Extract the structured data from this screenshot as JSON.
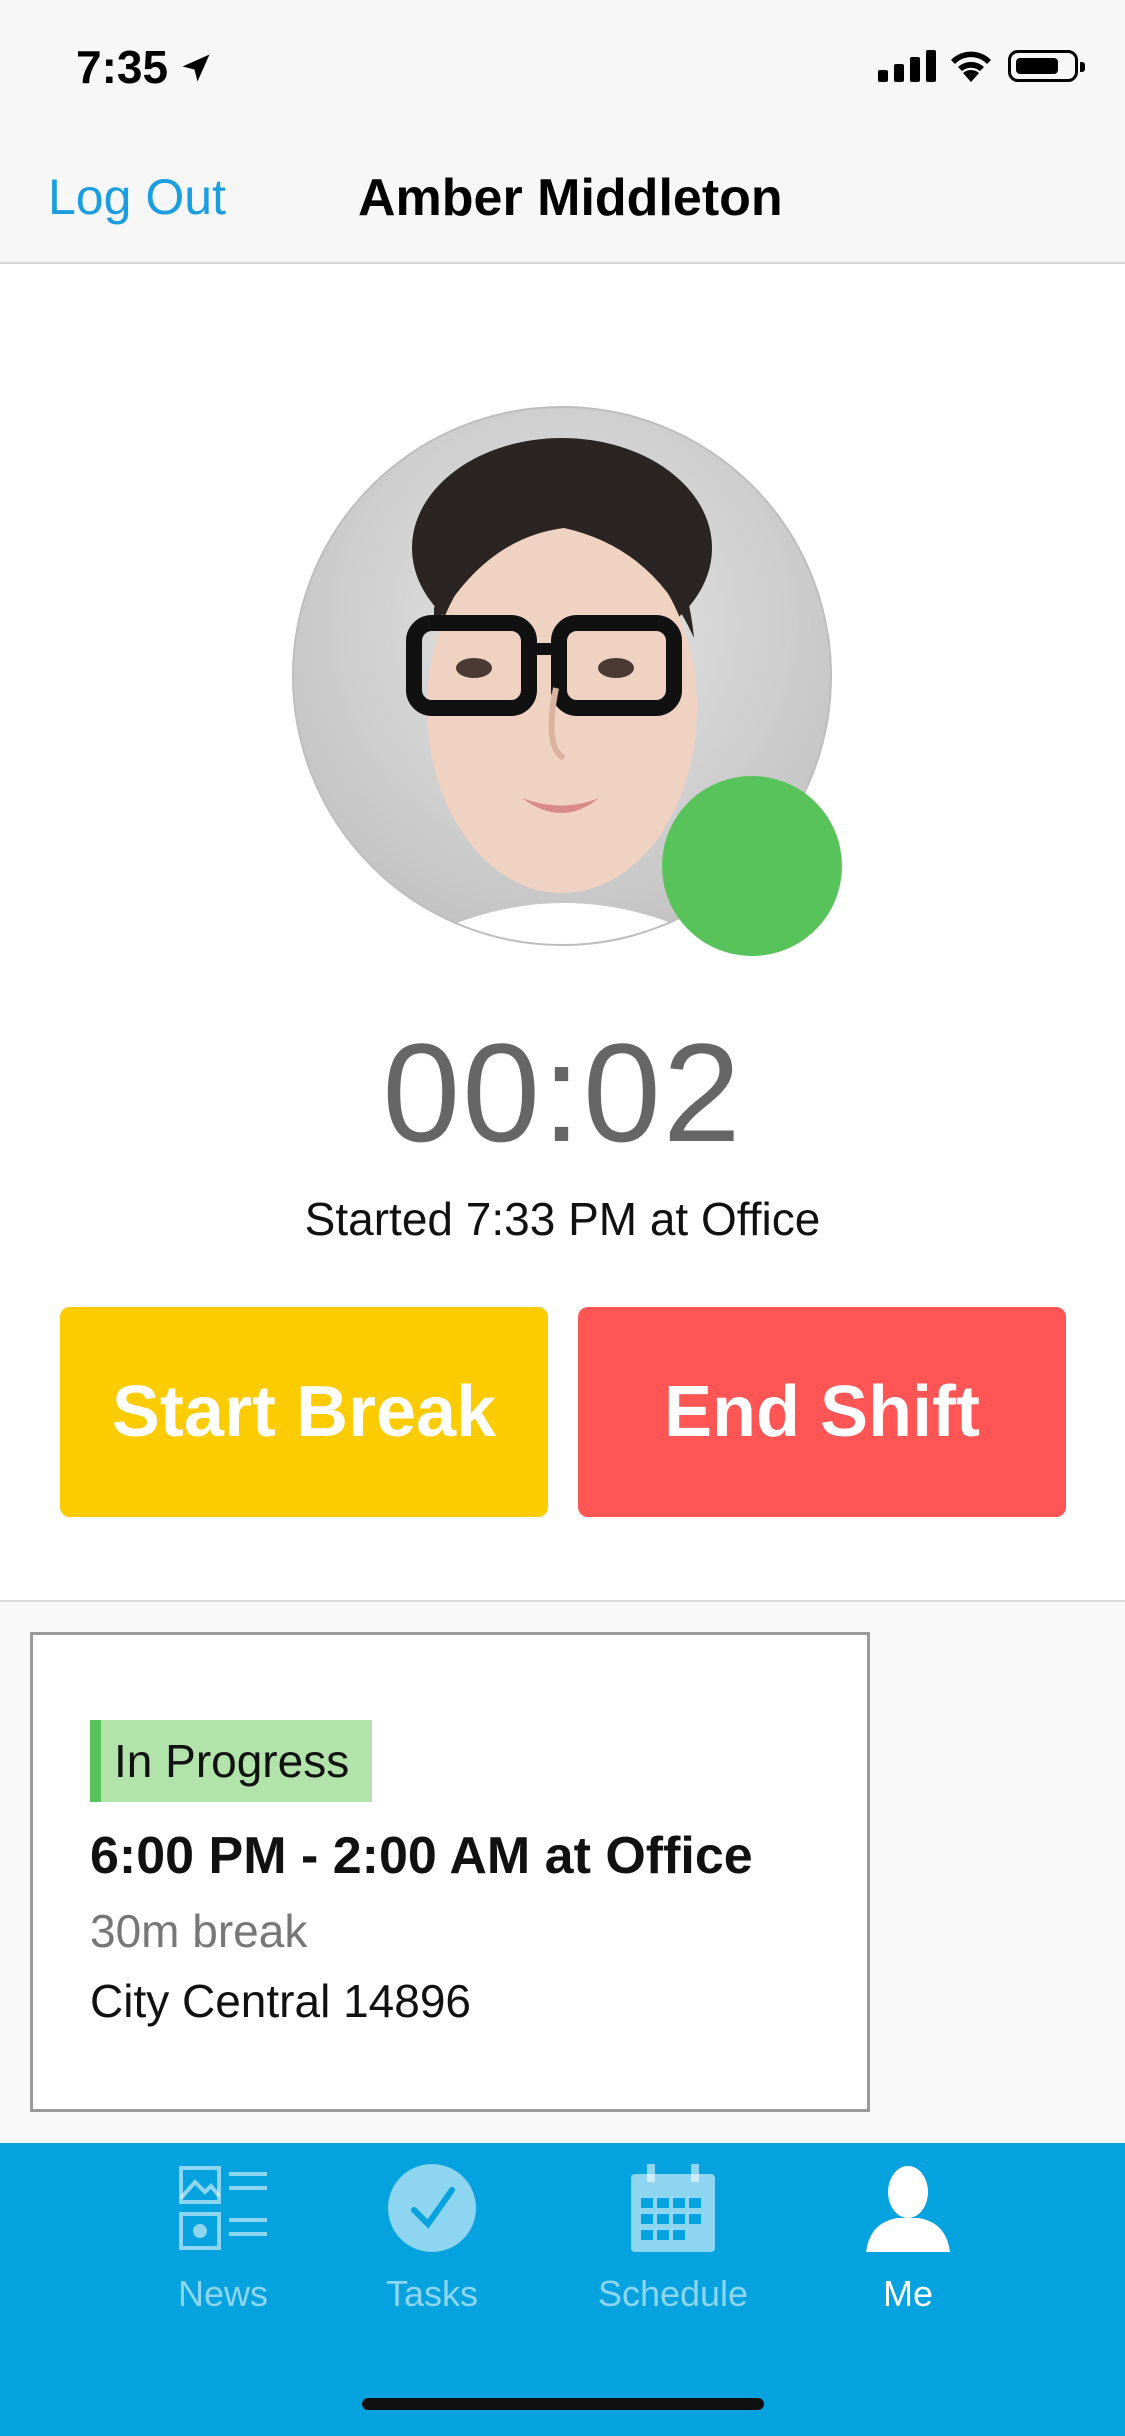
{
  "status_bar": {
    "time": "7:35"
  },
  "nav": {
    "logout_label": "Log Out",
    "title": "Amber Middleton"
  },
  "profile": {
    "timer": "00:02",
    "started_text": "Started 7:33 PM at Office",
    "status_color": "#57c35a"
  },
  "actions": {
    "start_break_label": "Start Break",
    "end_shift_label": "End Shift"
  },
  "shift_card": {
    "status": "In Progress",
    "time_range": "6:00 PM - 2:00 AM at Office",
    "break": "30m break",
    "location": "City Central 14896"
  },
  "tabs": [
    {
      "label": "News",
      "icon": "news-icon",
      "active": false
    },
    {
      "label": "Tasks",
      "icon": "tasks-check-icon",
      "active": false
    },
    {
      "label": "Schedule",
      "icon": "calendar-icon",
      "active": false
    },
    {
      "label": "Me",
      "icon": "person-icon",
      "active": true
    }
  ],
  "colors": {
    "accent": "#1a9ee0",
    "tabbar": "#04a2de",
    "break": "#fccb00",
    "end": "#ff5555",
    "progress": "#57c35a"
  }
}
